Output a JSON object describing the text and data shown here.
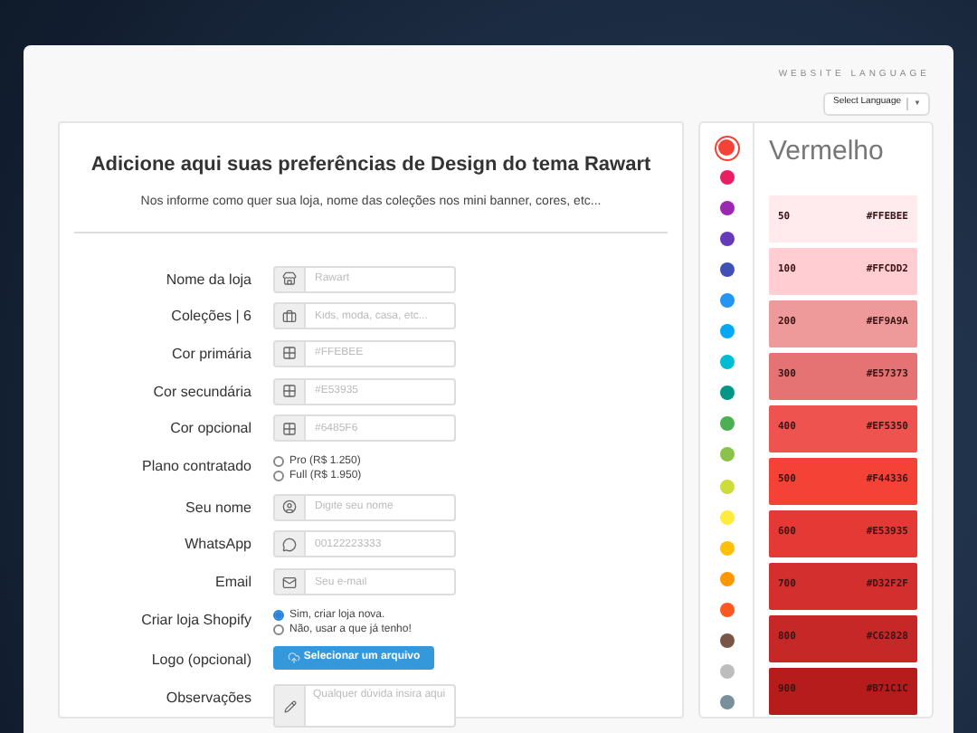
{
  "language": {
    "heading": "WEBSITE LANGUAGE",
    "select": "Select Language",
    "caret": "▼"
  },
  "form": {
    "title": "Adicione aqui suas preferências de Design do tema Rawart",
    "subtitle": "Nos informe como quer sua loja, nome das coleções nos mini banner, cores, etc...",
    "fields": [
      {
        "kind": "input",
        "label": "Nome da loja",
        "placeholder": "Rawart"
      },
      {
        "kind": "input",
        "label": "Coleções | 6",
        "placeholder": "Kids, moda, casa, etc..."
      },
      {
        "kind": "input",
        "label": "Cor primária",
        "placeholder": "#FFEBEE"
      },
      {
        "kind": "input",
        "label": "Cor secundária",
        "placeholder": "#E53935"
      },
      {
        "kind": "input",
        "label": "Cor opcional",
        "placeholder": "#6485F6"
      },
      {
        "kind": "radio",
        "label": "Plano contratado",
        "options": [
          {
            "label": "Pro (R$ 1.250)",
            "selected": false
          },
          {
            "label": "Full (R$ 1.950)",
            "selected": false
          }
        ]
      },
      {
        "kind": "input",
        "label": "Seu nome",
        "placeholder": "Digite seu nome"
      },
      {
        "kind": "input",
        "label": "WhatsApp",
        "placeholder": "00122223333"
      },
      {
        "kind": "input",
        "label": "Email",
        "placeholder": "Seu e-mail"
      },
      {
        "kind": "radio",
        "label": "Criar loja Shopify",
        "options": [
          {
            "label": "Sim, criar loja nova.",
            "selected": true
          },
          {
            "label": "Não, usar a que já tenho!",
            "selected": false
          }
        ]
      },
      {
        "kind": "file",
        "label": "Logo (opcional)",
        "button": "Selecionar um arquivo"
      },
      {
        "kind": "textarea",
        "label": "Observações",
        "placeholder": "Qualquer dúvida insira aqui"
      }
    ]
  },
  "palette": {
    "title": "Vermelho",
    "dots": [
      {
        "color": "#f44336",
        "selected": true
      },
      {
        "color": "#e91e63",
        "selected": false
      },
      {
        "color": "#9c27b0",
        "selected": false
      },
      {
        "color": "#673ab7",
        "selected": false
      },
      {
        "color": "#3f51b5",
        "selected": false
      },
      {
        "color": "#2196f3",
        "selected": false
      },
      {
        "color": "#03a9f4",
        "selected": false
      },
      {
        "color": "#00bcd4",
        "selected": false
      },
      {
        "color": "#009688",
        "selected": false
      },
      {
        "color": "#4caf50",
        "selected": false
      },
      {
        "color": "#8bc34a",
        "selected": false
      },
      {
        "color": "#cddc39",
        "selected": false
      },
      {
        "color": "#ffeb3b",
        "selected": false
      },
      {
        "color": "#ffc107",
        "selected": false
      },
      {
        "color": "#ff9800",
        "selected": false
      },
      {
        "color": "#ff5722",
        "selected": false
      },
      {
        "color": "#795548",
        "selected": false
      },
      {
        "color": "#bdbdbd",
        "selected": false
      },
      {
        "color": "#78909c",
        "selected": false
      }
    ],
    "swatches": [
      {
        "shade": "50",
        "hex": "#FFEBEE",
        "color": "#ffebee"
      },
      {
        "shade": "100",
        "hex": "#FFCDD2",
        "color": "#ffcdd2"
      },
      {
        "shade": "200",
        "hex": "#EF9A9A",
        "color": "#ef9a9a"
      },
      {
        "shade": "300",
        "hex": "#E57373",
        "color": "#e57373"
      },
      {
        "shade": "400",
        "hex": "#EF5350",
        "color": "#ef5350"
      },
      {
        "shade": "500",
        "hex": "#F44336",
        "color": "#f44336"
      },
      {
        "shade": "600",
        "hex": "#E53935",
        "color": "#e53935"
      },
      {
        "shade": "700",
        "hex": "#D32F2F",
        "color": "#d32f2f"
      },
      {
        "shade": "800",
        "hex": "#C62828",
        "color": "#c62828"
      },
      {
        "shade": "900",
        "hex": "#B71C1C",
        "color": "#b71c1c"
      }
    ]
  }
}
